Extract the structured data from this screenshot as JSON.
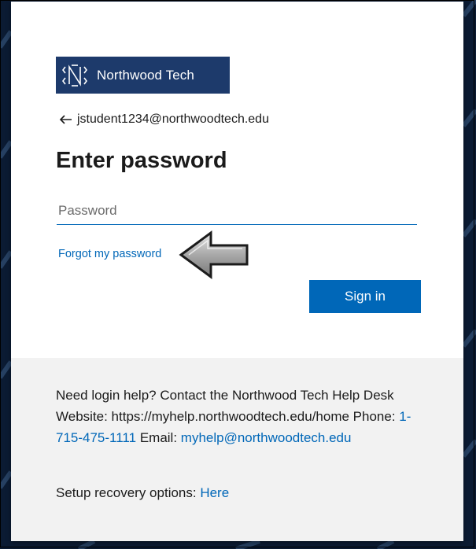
{
  "brand": {
    "name": "Northwood Tech",
    "color": "#1d3a6b"
  },
  "identity": {
    "email": "jstudent1234@northwoodtech.edu",
    "back_icon": "arrow-left-icon"
  },
  "form": {
    "title": "Enter password",
    "password_placeholder": "Password",
    "password_value": "",
    "forgot_label": "Forgot my password",
    "signin_label": "Sign in"
  },
  "help": {
    "intro": "Need login help? Contact the Northwood Tech Help Desk Website: https://myhelp.northwoodtech.edu/home Phone: ",
    "phone": "1-715-475-1111",
    "email_label": " Email: ",
    "email": "myhelp@northwoodtech.edu"
  },
  "recovery": {
    "label": "Setup recovery options: ",
    "link": "Here"
  },
  "colors": {
    "accent": "#0067b8",
    "footer_bg": "#f2f2f2",
    "page_bg": "#0b1b33"
  }
}
